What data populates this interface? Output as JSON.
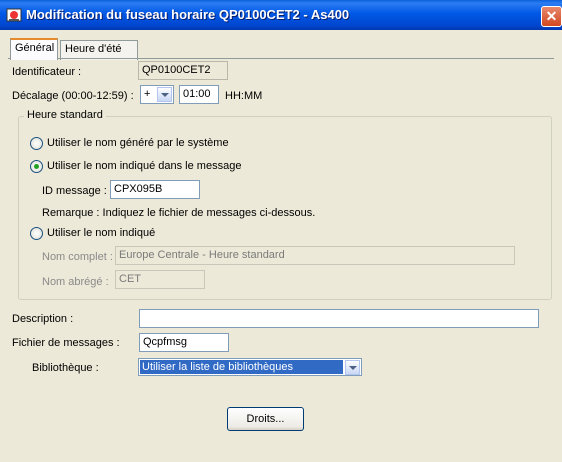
{
  "window": {
    "title": "Modification du fuseau horaire QP0100CET2 - As400",
    "close_label": "✕"
  },
  "tabs": [
    {
      "label": "Général",
      "active": true
    },
    {
      "label": "Heure d'été",
      "active": false
    }
  ],
  "identificateur": {
    "label": "Identificateur :",
    "value": "QP0100CET2"
  },
  "decalage": {
    "label": "Décalage (00:00-12:59) :",
    "sign": "+",
    "value": "01:00",
    "unit": "HH:MM"
  },
  "heure_standard": {
    "title": "Heure standard",
    "option_system": "Utiliser le nom généré par le système",
    "option_message": "Utiliser le nom indiqué dans le message",
    "selected": "message",
    "id_message_label": "ID message :",
    "id_message_value": "CPX095B",
    "remarque": "Remarque : Indiquez le fichier de messages ci-dessous.",
    "option_nom": "Utiliser le nom indiqué",
    "nom_complet_label": "Nom complet :",
    "nom_complet_value": "Europe Centrale - Heure standard",
    "nom_abrege_label": "Nom abrégé :",
    "nom_abrege_value": "CET"
  },
  "description": {
    "label": "Description :",
    "value": ""
  },
  "fichier_messages": {
    "label": "Fichier de messages :",
    "value": "Qcpfmsg"
  },
  "bibliotheque": {
    "label": "Bibliothèque :",
    "value": "Utiliser la liste de bibliothèques"
  },
  "droits_button": "Droits...",
  "colors": {
    "titlebar": "#0058e6",
    "window_bg": "#ece9d8",
    "selection": "#316ac5"
  }
}
